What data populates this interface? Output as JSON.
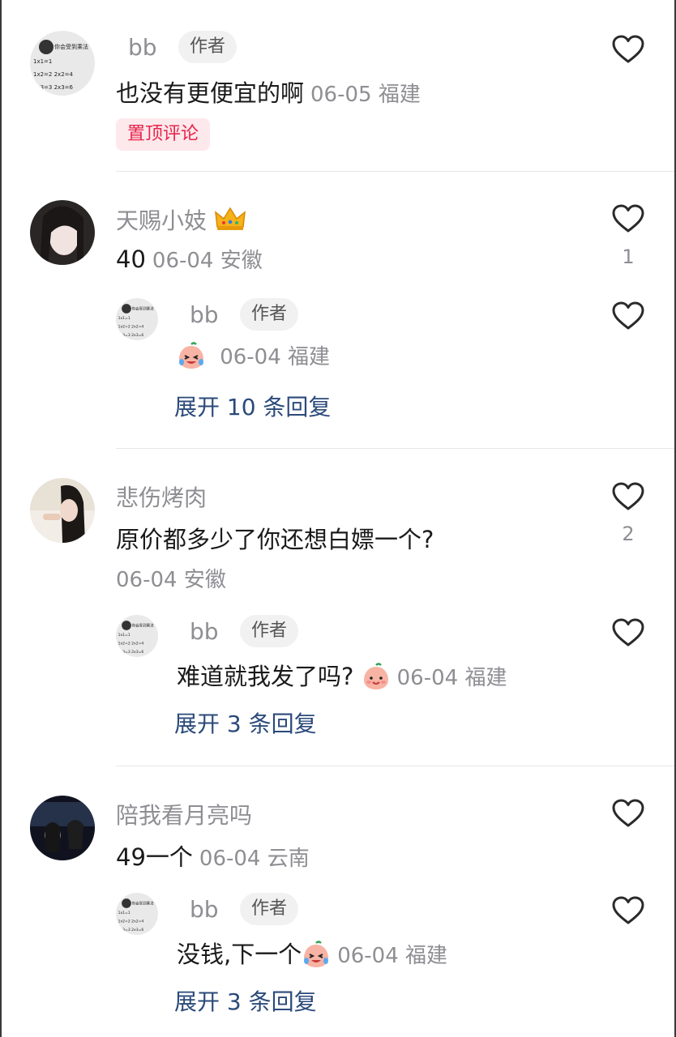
{
  "comments": [
    {
      "name": "bb",
      "author_badge": "作者",
      "text": "也没有更便宜的啊",
      "meta": "06-05 福建",
      "pin_label": "置顶评论"
    },
    {
      "name": "天赐小妓",
      "text": "40",
      "meta": "06-04 安徽",
      "likes": "1",
      "reply": {
        "name": "bb",
        "author_badge": "作者",
        "text": "",
        "meta": "06-04 福建"
      },
      "expand_label": "展开 10 条回复"
    },
    {
      "name": "悲伤烤肉",
      "text": "原价都多少了你还想白嫖一个?",
      "meta": "06-04 安徽",
      "likes": "2",
      "reply": {
        "name": "bb",
        "author_badge": "作者",
        "text": "难道就我发了吗?",
        "meta": "06-04 福建"
      },
      "expand_label": "展开 3 条回复"
    },
    {
      "name": "陪我看月亮吗",
      "text": "49一个",
      "meta": "06-04 云南",
      "reply": {
        "name": "bb",
        "author_badge": "作者",
        "text": "没钱,下一个",
        "meta": "06-04 福建"
      },
      "expand_label": "展开 3 条回复"
    }
  ],
  "avatar_text": {
    "title": "你会受到乘法",
    "line1": "1x1=1",
    "line2": "1x2=2 2x2=4",
    "line3": "1x3=3 2x3=6"
  },
  "icons": {
    "like": "heart-outline-icon",
    "crown": "crown-icon",
    "emoji_laugh_cry": "laugh-cry-peach-emoji",
    "emoji_smile": "smile-peach-emoji"
  },
  "colors": {
    "name_gray": "#8e8e93",
    "expand_blue": "#2b4a7a",
    "pin_red": "#e8254a",
    "pin_bg": "#fde8ec"
  }
}
